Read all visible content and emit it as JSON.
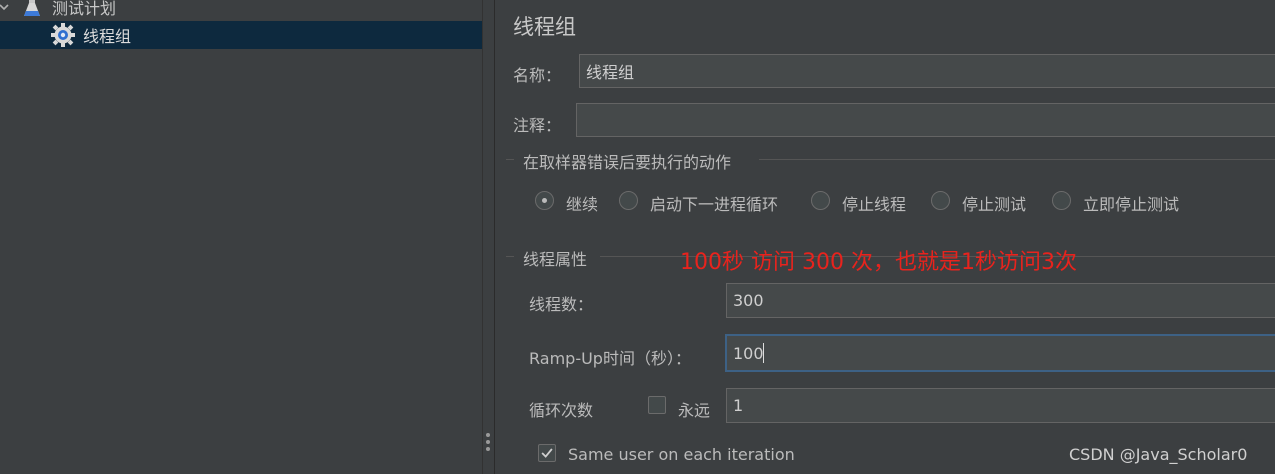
{
  "tree": {
    "root_label": "测试计划",
    "child_label": "线程组"
  },
  "panel": {
    "title": "线程组",
    "name_label": "名称：",
    "name_value": "线程组",
    "comment_label": "注释：",
    "comment_value": "",
    "error_section_label": "在取样器错误后要执行的动作",
    "error_actions": [
      "继续",
      "启动下一进程循环",
      "停止线程",
      "停止测试",
      "立即停止测试"
    ],
    "selected_error_action": "继续",
    "thread_section_label": "线程属性",
    "annotation": "100秒 访问 300 次，也就是1秒访问3次",
    "threads_label": "线程数：",
    "threads_value": "300",
    "rampup_label": "Ramp-Up时间（秒）：",
    "rampup_value": "100",
    "loop_label": "循环次数",
    "forever_label": "永远",
    "forever_checked": false,
    "loop_value": "1",
    "same_user_label": "Same user on each iteration",
    "same_user_checked": true
  },
  "watermark": "CSDN @Java_Scholar0",
  "colors": {
    "background": "#3c3f41",
    "selection": "#0d293e",
    "field_bg": "#45494a",
    "focus_border": "#3d6185",
    "annotation": "#e8231d"
  }
}
